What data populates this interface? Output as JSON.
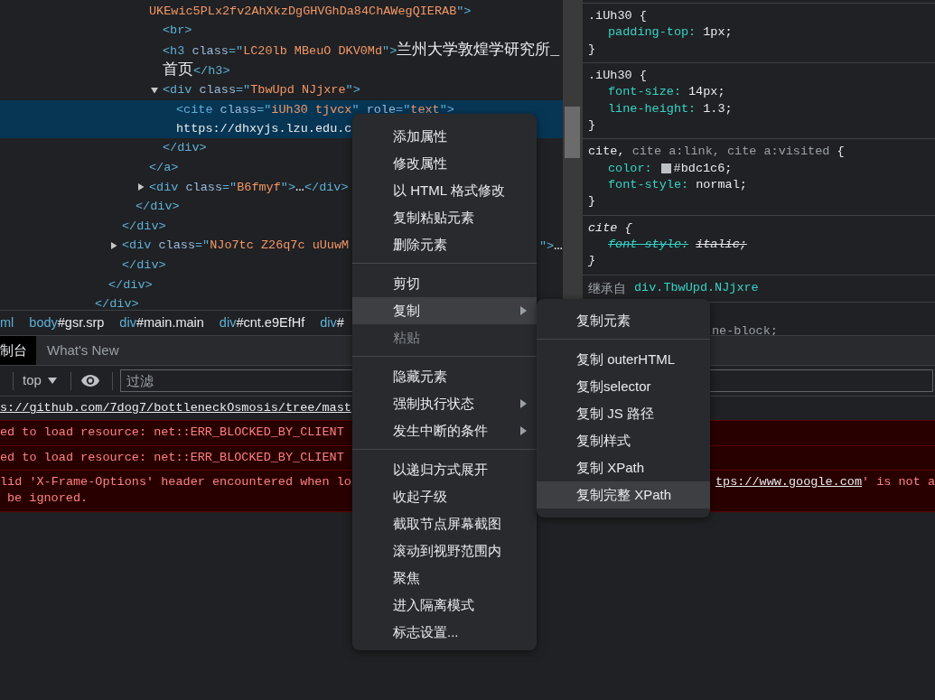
{
  "elements_panel": {
    "dom_tree": [
      {
        "selected": false,
        "children": [
          {
            "selected": false,
            "children": [
              {
                "selected": false,
                "children": [
                  {
                    "selected": false,
                    "children": [
                      {
                        "open": [
                          {
                            "kind": "value",
                            "text": "UKEwic5PLx2fv2AhXkzDgGHVGhDa84ChAWegQIERAB"
                          },
                          {
                            "kind": "tag",
                            "text": "\">"
                          }
                        ],
                        "selected": false,
                        "children": [
                          {
                            "open": [
                              {
                                "kind": "tag",
                                "text": "<br>"
                              }
                            ],
                            "selected": false
                          },
                          {
                            "open": [
                              {
                                "kind": "tag",
                                "text": "<h3"
                              },
                              {
                                "kind": "attr",
                                "text": " class"
                              },
                              {
                                "kind": "tag",
                                "text": "=\""
                              },
                              {
                                "kind": "value",
                                "text": "LC20lb MBeuO DKV0Md"
                              },
                              {
                                "kind": "tag",
                                "text": "\">"
                              },
                              {
                                "kind": "text",
                                "text": "兰州大学敦煌学研究所_首页"
                              },
                              {
                                "kind": "tag",
                                "text": "</h3>"
                              }
                            ],
                            "selected": false
                          },
                          {
                            "open": [
                              {
                                "kind": "tag",
                                "text": "<div"
                              },
                              {
                                "kind": "attr",
                                "text": " class"
                              },
                              {
                                "kind": "tag",
                                "text": "=\""
                              },
                              {
                                "kind": "value",
                                "text": "TbwUpd NJjxre"
                              },
                              {
                                "kind": "tag",
                                "text": "\">"
                              }
                            ],
                            "expanded": true,
                            "selected": false,
                            "children": [
                              {
                                "open": [
                                  {
                                    "kind": "tag",
                                    "text": "<cite"
                                  },
                                  {
                                    "kind": "attr",
                                    "text": " class"
                                  },
                                  {
                                    "kind": "tag",
                                    "text": "=\""
                                  },
                                  {
                                    "kind": "value",
                                    "text": "iUh30 tjvcx"
                                  },
                                  {
                                    "kind": "tag",
                                    "text": "\""
                                  },
                                  {
                                    "kind": "attr",
                                    "text": " role"
                                  },
                                  {
                                    "kind": "tag",
                                    "text": "=\""
                                  },
                                  {
                                    "kind": "value",
                                    "text": "text"
                                  },
                                  {
                                    "kind": "tag",
                                    "text": "\">"
                                  }
                                ],
                                "text": "https://dhxyjs.lzu.edu.c",
                                "selected": true
                              }
                            ],
                            "close": [
                              {
                                "kind": "tag",
                                "text": "</div>"
                              }
                            ]
                          }
                        ],
                        "close": [
                          {
                            "kind": "tag",
                            "text": "</a>"
                          }
                        ]
                      },
                      {
                        "open": [
                          {
                            "kind": "tag",
                            "text": "<div"
                          },
                          {
                            "kind": "attr",
                            "text": " class"
                          },
                          {
                            "kind": "tag",
                            "text": "=\""
                          },
                          {
                            "kind": "value",
                            "text": "B6fmyf"
                          },
                          {
                            "kind": "tag",
                            "text": "\">"
                          },
                          {
                            "kind": "text",
                            "text": "…"
                          },
                          {
                            "kind": "tag",
                            "text": "</div>"
                          }
                        ],
                        "expanded": false,
                        "selected": false
                      }
                    ],
                    "close": [
                      {
                        "kind": "tag",
                        "text": "</div>"
                      }
                    ]
                  }
                ],
                "close": [
                  {
                    "kind": "tag",
                    "text": "</div>"
                  }
                ]
              },
              {
                "open": [
                  {
                    "kind": "tag",
                    "text": "<div"
                  },
                  {
                    "kind": "attr",
                    "text": " class"
                  },
                  {
                    "kind": "tag",
                    "text": "=\""
                  },
                  {
                    "kind": "value",
                    "text": "NJo7tc Z26q7c uUuwM"
                  }
                ],
                "open_tail": [
                  {
                    "kind": "tag",
                    "text": "\">"
                  },
                  {
                    "kind": "text",
                    "text": "…"
                  }
                ],
                "expanded": false,
                "selected": false,
                "close": [
                  {
                    "kind": "tag",
                    "text": "</div>"
                  }
                ]
              }
            ],
            "close": [
              {
                "kind": "tag",
                "text": "</div>"
              }
            ]
          }
        ],
        "close": [
          {
            "kind": "tag",
            "text": "</div>"
          }
        ]
      }
    ],
    "breadcrumbs": [
      {
        "tag": "ml"
      },
      {
        "tag": "body",
        "rest": "#gsr.srp"
      },
      {
        "tag": "div",
        "rest": "#main.main"
      },
      {
        "tag": "div",
        "rest": "#cnt.e9EfHf"
      },
      {
        "tag": "div",
        "rest": "#"
      }
    ]
  },
  "styles_pane": {
    "rules": [
      {
        "selector": [
          {
            "text": ".iUh30",
            "matched": true
          }
        ],
        "open": "{",
        "declarations": [
          {
            "property": "padding-top:",
            "value": "1px;",
            "overridden": false
          }
        ],
        "close": "}",
        "user_agent": false
      },
      {
        "selector": [
          {
            "text": ".iUh30",
            "matched": true
          }
        ],
        "open": "{",
        "declarations": [
          {
            "property": "font-size:",
            "value": "14px;",
            "overridden": false
          },
          {
            "property": "line-height:",
            "value": "1.3;",
            "overridden": false
          }
        ],
        "close": "}",
        "user_agent": false
      },
      {
        "selector": [
          {
            "text": "cite,",
            "matched": true
          },
          {
            "text": "cite a:link, cite a:visited",
            "matched": false
          }
        ],
        "open": "{",
        "declarations": [
          {
            "property": "color:",
            "color": "#bdc1c6",
            "value": "#bdc1c6;",
            "overridden": false
          },
          {
            "property": "font-style:",
            "value": "normal;",
            "overridden": false
          }
        ],
        "close": "}",
        "user_agent": false
      },
      {
        "selector": [
          {
            "text": "cite",
            "matched": true
          }
        ],
        "open": "{",
        "declarations": [
          {
            "property": "font-style:",
            "value": "italic;",
            "overridden": true
          }
        ],
        "close": "}",
        "user_agent": true
      }
    ],
    "inherited_header": {
      "label": "继承自",
      "selector": "div.TbwUpd.NJjxre"
    },
    "inherited_rules": [
      {
        "visible_text": "ne-block;"
      }
    ]
  },
  "drawer": {
    "tabs": [
      {
        "label": "制台",
        "selected": true
      },
      {
        "label": "What's New",
        "selected": false
      }
    ],
    "toolbar": {
      "context": "top",
      "filter": {
        "placeholder": "过滤"
      }
    },
    "messages": [
      {
        "kind": "log",
        "lines": [
          {
            "left": [
              {
                "text": "s://github.com/7dog7/bottleneckOsmosis/tree/mast",
                "link": true
              }
            ]
          }
        ]
      },
      {
        "kind": "error",
        "lines": [
          {
            "left": [
              {
                "text": "ed to load resource: net::ERR_BLOCKED_BY_CLIENT",
                "link": false
              }
            ]
          }
        ]
      },
      {
        "kind": "error",
        "lines": [
          {
            "left": [
              {
                "text": "ed to load resource: net::ERR_BLOCKED_BY_CLIENT",
                "link": false
              }
            ]
          }
        ]
      },
      {
        "kind": "error",
        "lines": [
          {
            "left": [
              {
                "text": "lid 'X-Frame-Options' header encountered when lo",
                "link": false
              }
            ],
            "right": [
              {
                "text": "tps://www.google.com",
                "link": true
              },
              {
                "text": "' is not a",
                "link": false
              }
            ]
          },
          {
            "left": [
              {
                "text": "be ignored.",
                "link": false
              }
            ]
          }
        ]
      }
    ]
  },
  "context_menu": {
    "groups": [
      {
        "items": [
          {
            "label": "添加属性",
            "selected": false,
            "disabled": false,
            "has_submenu": false
          },
          {
            "label": "修改属性",
            "selected": false,
            "disabled": false,
            "has_submenu": false
          },
          {
            "label": "以 HTML 格式修改",
            "selected": false,
            "disabled": false,
            "has_submenu": false
          },
          {
            "label": "复制粘贴元素",
            "selected": false,
            "disabled": false,
            "has_submenu": false
          },
          {
            "label": "删除元素",
            "selected": false,
            "disabled": false,
            "has_submenu": false
          }
        ]
      },
      {
        "items": [
          {
            "label": "剪切",
            "selected": false,
            "disabled": false,
            "has_submenu": false
          },
          {
            "label": "复制",
            "selected": true,
            "disabled": false,
            "has_submenu": true
          },
          {
            "label": "粘贴",
            "selected": false,
            "disabled": true,
            "has_submenu": false
          }
        ]
      },
      {
        "items": [
          {
            "label": "隐藏元素",
            "selected": false,
            "disabled": false,
            "has_submenu": false
          },
          {
            "label": "强制执行状态",
            "selected": false,
            "disabled": false,
            "has_submenu": true
          },
          {
            "label": "发生中断的条件",
            "selected": false,
            "disabled": false,
            "has_submenu": true
          }
        ]
      },
      {
        "items": [
          {
            "label": "以递归方式展开",
            "selected": false,
            "disabled": false,
            "has_submenu": false
          },
          {
            "label": "收起子级",
            "selected": false,
            "disabled": false,
            "has_submenu": false
          },
          {
            "label": "截取节点屏幕截图",
            "selected": false,
            "disabled": false,
            "has_submenu": false
          },
          {
            "label": "滚动到视野范围内",
            "selected": false,
            "disabled": false,
            "has_submenu": false
          },
          {
            "label": "聚焦",
            "selected": false,
            "disabled": false,
            "has_submenu": false
          },
          {
            "label": "进入隔离模式",
            "selected": false,
            "disabled": false,
            "has_submenu": false
          },
          {
            "label": "标志设置...",
            "selected": false,
            "disabled": false,
            "has_submenu": false
          }
        ]
      }
    ],
    "submenu": {
      "groups": [
        {
          "items": [
            {
              "label": "复制元素",
              "selected": false
            }
          ]
        },
        {
          "items": [
            {
              "label": "复制 outerHTML",
              "selected": false
            },
            {
              "label": "复制selector",
              "selected": false
            },
            {
              "label": "复制 JS 路径",
              "selected": false
            },
            {
              "label": "复制样式",
              "selected": false
            },
            {
              "label": "复制 XPath",
              "selected": false
            },
            {
              "label": "复制完整 XPath",
              "selected": true
            }
          ]
        }
      ]
    }
  }
}
